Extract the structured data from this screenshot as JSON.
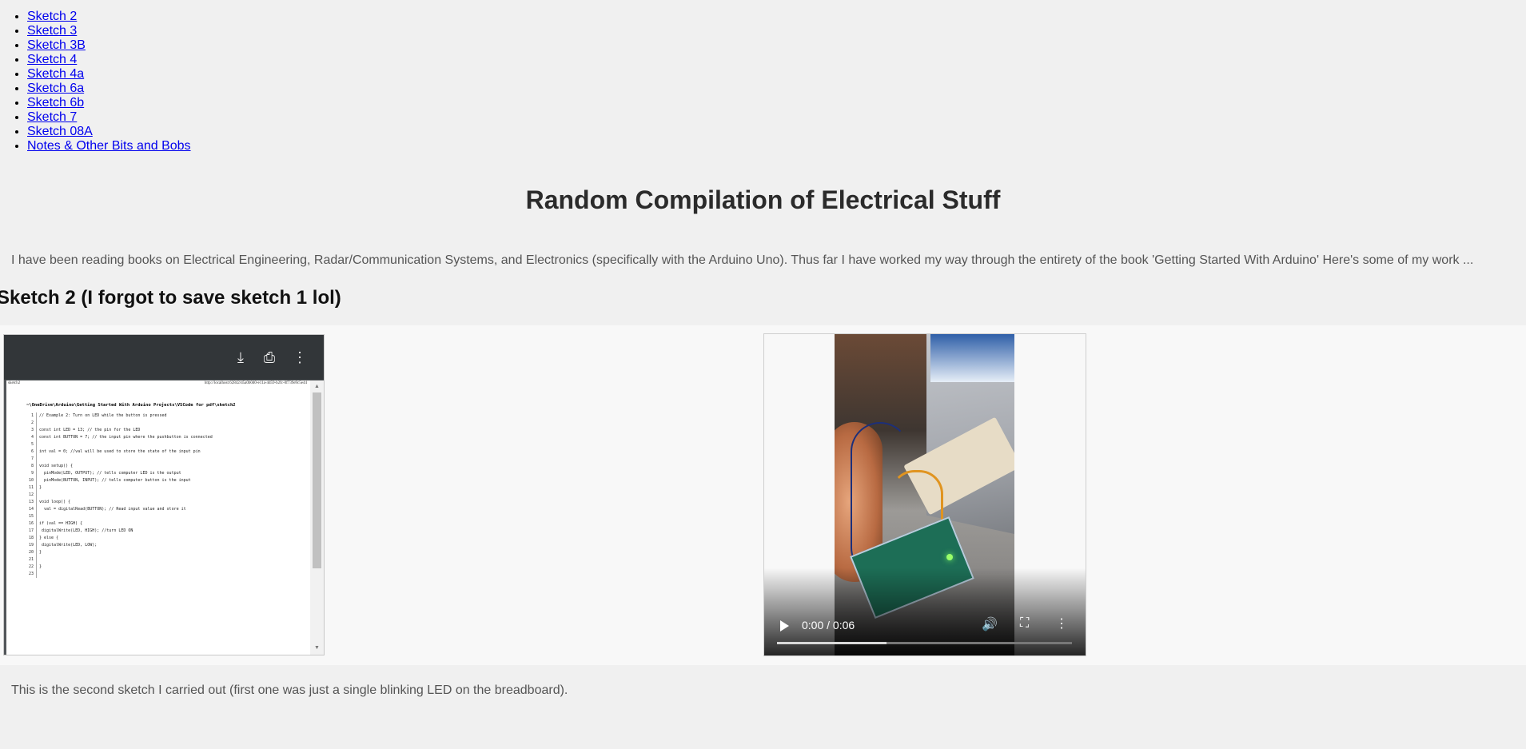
{
  "nav": {
    "links": [
      "Sketch 2",
      "Sketch 3",
      "Sketch 3B",
      "Sketch 4",
      "Sketch 4a",
      "Sketch 6a",
      "Sketch 6b",
      "Sketch 7",
      "Sketch 08A",
      "Notes & Other Bits and Bobs"
    ]
  },
  "page": {
    "title": "Random Compilation of Electrical Stuff",
    "intro": "I have been reading books on Electrical Engineering, Radar/Communication Systems, and Electronics (specifically with the Arduino Uno). Thus far I have worked my way through the entirety of the book 'Getting Started With Arduino' Here's some of my work ..."
  },
  "sketch": {
    "heading": "Sketch 2 (I forgot to save sketch 1 lol)",
    "caption": "This is the second sketch I carried out (first one was just a single blinking LED on the breadboard)."
  },
  "pdf": {
    "toolbar_icons": [
      "download-icon",
      "print-icon",
      "more-vert-icon"
    ],
    "header_left": "sketch2",
    "header_right": "http://localhost:62842/d5a0b0d0-e11a-4d59-b2fc-0f739e9c5e44",
    "path": "~\\OneDrive\\Arduino\\Getting Started With Arduino Projects\\VSCode for pdf\\sketch2",
    "code_lines": [
      "// Example 2: Turn on LED while the button is pressed",
      "",
      "const int LED = 13; // the pin for the LED",
      "const int BUTTON = 7; // the input pin where the pushbutton is connected",
      "",
      "int val = 0; //val will be used to store the state of the input pin",
      "",
      "void setup() {",
      "  pinMode(LED, OUTPUT); // tells computer LED is the output",
      "  pinMode(BUTTON, INPUT); // tells computer button is the input",
      "}",
      "",
      "void loop() {",
      "  val = digitalRead(BUTTON); // Read input value and store it",
      "",
      "if (val == HIGH) {",
      " digitalWrite(LED, HIGH); //turn LED ON",
      "} else {",
      " digitalWrite(LED, LOW);",
      "}",
      "",
      "}",
      ""
    ]
  },
  "video": {
    "time": "0:00 / 0:06",
    "progress": 0.37,
    "icons": [
      "play-icon",
      "volume-icon",
      "fullscreen-icon",
      "more-vert-icon"
    ]
  }
}
